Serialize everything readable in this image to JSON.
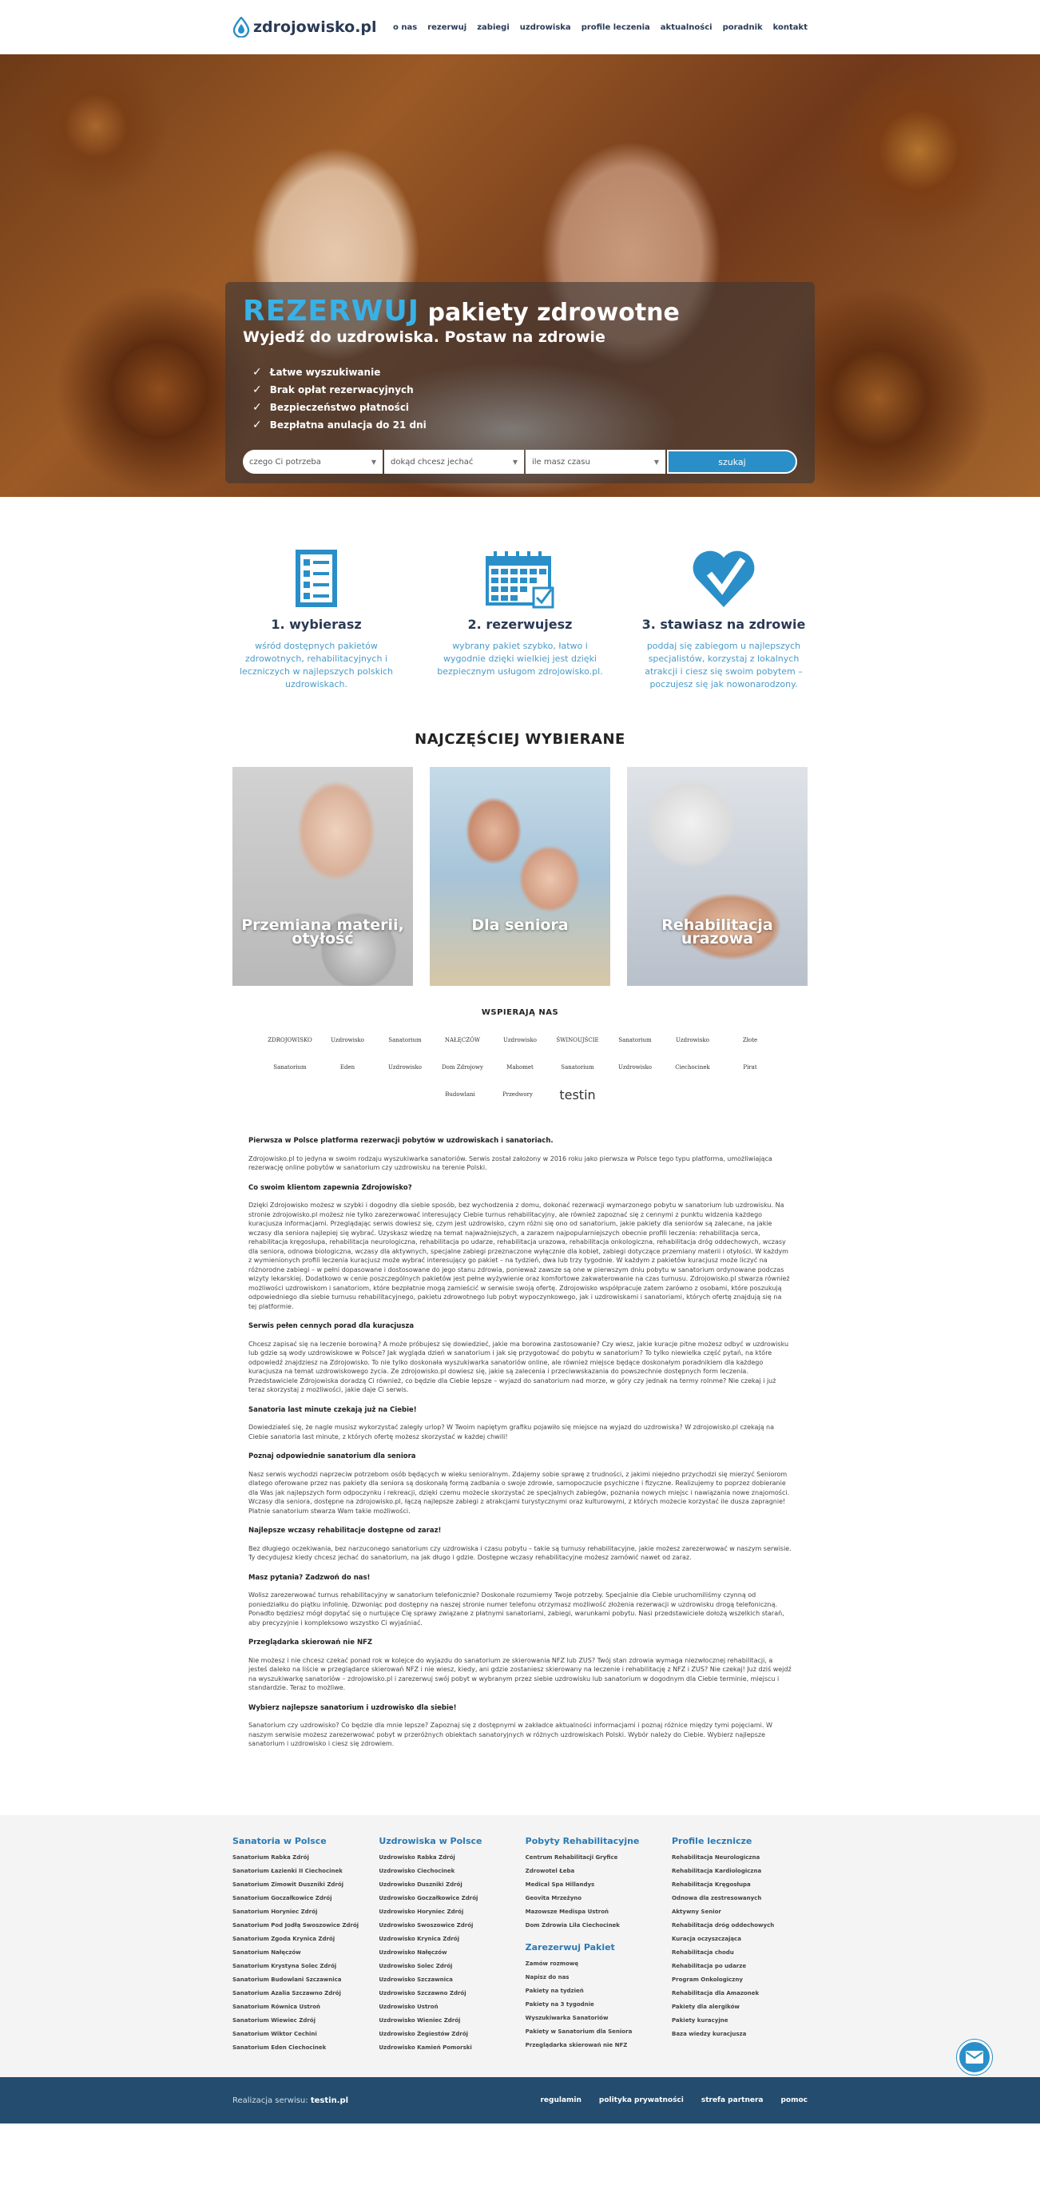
{
  "header": {
    "logo_text": "zdrojowisko.pl",
    "nav": [
      "o nas",
      "rezerwuj",
      "zabiegi",
      "uzdrowiska",
      "profile leczenia",
      "aktualności",
      "poradnik",
      "kontakt"
    ]
  },
  "hero": {
    "title_accent": "REZERWUJ",
    "title_rest": "pakiety zdrowotne",
    "subtitle": "Wyjedź do uzdrowiska. Postaw na zdrowie",
    "benefits": [
      "Łatwe wyszukiwanie",
      "Brak opłat rezerwacyjnych",
      "Bezpieczeństwo płatności",
      "Bezpłatna anulacja do 21 dni"
    ],
    "search": {
      "need": "czego Ci potrzeba",
      "where": "dokąd chcesz jechać",
      "time": "ile masz czasu",
      "button": "szukaj"
    }
  },
  "steps": [
    {
      "title": "1. wybierasz",
      "text": "wśród dostępnych pakietów zdrowotnych, rehabilitacyjnych i leczniczych w najlepszych polskich uzdrowiskach."
    },
    {
      "title": "2. rezerwujesz",
      "text": "wybrany pakiet szybko, łatwo i wygodnie dzięki wielkiej jest dzięki bezpiecznym usługom zdrojowisko.pl."
    },
    {
      "title": "3. stawiasz na zdrowie",
      "text": "poddaj się zabiegom u najlepszych specjalistów, korzystaj z lokalnych atrakcji i ciesz się swoim pobytem – poczujesz się jak nowonarodzony."
    }
  ],
  "popular": {
    "title": "NAJCZĘŚCIEJ WYBIERANE",
    "cards": [
      "Przemiana materii, otyłość",
      "Dla seniora",
      "Rehabilitacja urazowa"
    ]
  },
  "sponsors": {
    "title": "WSPIERAJĄ NAS",
    "logos": [
      "ZDROJOWISKO",
      "Uzdrowisko",
      "Sanatorium",
      "NAŁĘCZÓW",
      "Uzdrowisko",
      "ŚWINOUJŚCIE",
      "Sanatorium",
      "Uzdrowisko",
      "Złote",
      "Sanatorium",
      "Eden",
      "Uzdrowisko",
      "Dom Zdrojowy",
      "Mahomet",
      "Sanatorium",
      "Uzdrowisko",
      "Ciechocinek",
      "Pirat",
      "Budowlani",
      "Przedwory",
      "testin"
    ]
  },
  "article": {
    "intro_head": "Pierwsza w Polsce platforma rezerwacji pobytów w uzdrowiskach i sanatoriach.",
    "intro": "Zdrojowisko.pl to jedyna w swoim rodzaju wyszukiwarka sanatoriów. Serwis został założony w 2016 roku jako pierwsza w Polsce tego typu platforma, umożliwiająca rezerwację online pobytów w sanatorium czy uzdrowisku na terenie Polski.",
    "sections": [
      {
        "h": "Co swoim klientom zapewnia Zdrojowisko?",
        "p": "Dzięki Zdrojowisko możesz w szybki i dogodny dla siebie sposób, bez wychodzenia z domu, dokonać rezerwacji wymarzonego pobytu w sanatorium lub uzdrowisku. Na stronie zdrojowisko.pl możesz nie tylko zarezerwować interesujący Ciebie turnus rehabilitacyjny, ale również zapoznać się z cennymi z punktu widzenia każdego kuracjusza informacjami. Przeglądając serwis dowiesz się, czym jest uzdrowisko, czym różni się ono od sanatorium, jakie pakiety dla seniorów są zalecane, na jakie wczasy dla seniora najlepiej się wybrać. Uzyskasz wiedzę na temat najważniejszych, a zarazem najpopularniejszych obecnie profili leczenia: rehabilitacja serca, rehabilitacja kręgosłupa, rehabilitacja neurologiczna, rehabilitacja po udarze, rehabilitacja urazowa, rehabilitacja onkologiczna, rehabilitacja dróg oddechowych, wczasy dla seniora, odnowa biologiczna, wczasy dla aktywnych, specjalne zabiegi przeznaczone wyłącznie dla kobiet, zabiegi dotyczące przemiany materii i otyłości. W każdym z wymienionych profili leczenia kuracjusz może wybrać interesujący go pakiet – na tydzień, dwa lub trzy tygodnie. W każdym z pakietów kuracjusz może liczyć na różnorodne zabiegi – w pełni dopasowane i dostosowane do jego stanu zdrowia, ponieważ zawsze są one w pierwszym dniu pobytu w sanatorium ordynowane podczas wizyty lekarskiej. Dodatkowo w cenie poszczególnych pakietów jest pełne wyżywienie oraz komfortowe zakwaterowanie na czas turnusu. Zdrojowisko.pl stwarza również możliwości uzdrowiskom i sanatoriom, które bezpłatnie mogą zamieścić w serwisie swoją ofertę. Zdrojowisko współpracuje zatem zarówno z osobami, które poszukują odpowiedniego dla siebie turnusu rehabilitacyjnego, pakietu zdrowotnego lub pobyt wypoczynkowego, jak i uzdrowiskami i sanatoriami, których ofertę znajdują się na tej platformie."
      },
      {
        "h": "Serwis pełen cennych porad dla kuracjusza",
        "p": "Chcesz zapisać się na leczenie borowiną? A może próbujesz się dowiedzieć, jakie ma borowina zastosowanie? Czy wiesz, jakie kuracje pitne możesz odbyć w uzdrowisku lub gdzie są wody uzdrowiskowe w Polsce? Jak wygląda dzień w sanatorium i jak się przygotować do pobytu w sanatorium? To tylko niewielka część pytań, na które odpowiedź znajdziesz na Zdrojowisko. To nie tylko doskonała wyszukiwarka sanatoriów online, ale również miejsce będące doskonałym poradnikiem dla każdego kuracjusza na temat uzdrowiskowego życia. Ze zdrojowisko.pl dowiesz się, jakie są zalecenia i przeciwwskazania do powszechnie dostępnych form leczenia. Przedstawiciele Zdrojowiska doradzą Ci również, co będzie dla Ciebie lepsze – wyjazd do sanatorium nad morze, w góry czy jednak na termy rolnme? Nie czekaj i już teraz skorzystaj z możliwości, jakie daje Ci serwis."
      },
      {
        "h": "Sanatoria last minute czekają już na Ciebie!",
        "p": "Dowiedziałeś się, że nagle musisz wykorzystać zaległy urlop? W Twoim napiętym grafiku pojawiło się miejsce na wyjazd do uzdrowiska? W zdrojowisko.pl czekają na Ciebie sanatoria last minute, z których ofertę możesz skorzystać w każdej chwili!"
      },
      {
        "h": "Poznaj odpowiednie sanatorium dla seniora",
        "p": "Nasz serwis wychodzi naprzeciw potrzebom osób będących w wieku senioralnym. Zdajemy sobie sprawę z trudności, z jakimi niejedno przychodzi się mierzyć Seniorom dlatego oferowane przez nas pakiety dla seniora są doskonałą formą zadbania o swoje zdrowie, samopoczucie psychiczne i fizyczne. Realizujemy to poprzez dobieranie dla Was jak najlepszych form odpoczynku i rekreacji, dzięki czemu możecie skorzystać ze specjalnych zabiegów, poznania nowych miejsc i nawiązania nowe znajomości. Wczasy dla seniora, dostępne na zdrojowisko.pl, łączą najlepsze zabiegi z atrakcjami turystycznymi oraz kulturowymi, z których możecie korzystać ile dusza zapragnie! Platnie sanatorium stwarza Wam takie możliwości."
      },
      {
        "h": "Najlepsze wczasy rehabilitacje dostępne od zaraz!",
        "p": "Bez długiego oczekiwania, bez narzuconego sanatorium czy uzdrowiska i czasu pobytu – takie są turnusy rehabilitacyjne, jakie możesz zarezerwować w naszym serwisie. Ty decydujesz kiedy chcesz jechać do sanatorium, na jak długo i gdzie. Dostępne wczasy rehabilitacyjne możesz zamówić nawet od zaraz."
      },
      {
        "h": "Masz pytania? Zadzwoń do nas!",
        "p": "Wolisz zarezerwować turnus rehabilitacyjny w sanatorium telefonicznie? Doskonale rozumiemy Twoje potrzeby. Specjalnie dla Ciebie uruchomiliśmy czynną od poniedziałku do piątku infolinię. Dzwoniąc pod dostępny na naszej stronie numer telefonu otrzymasz możliwość złożenia rezerwacji w uzdrowisku drogą telefoniczną. Ponadto będziesz mógł dopytać się o nurtujące Cię sprawy związane z płatnymi sanatoriami, zabiegi, warunkami pobytu. Nasi przedstawiciele dołożą wszelkich starań, aby precyzyjnie i kompleksowo wszystko Ci wyjaśniać."
      },
      {
        "h": "Przeglądarka skierowań nie NFZ",
        "p": "Nie możesz i nie chcesz czekać ponad rok w kolejce do wyjazdu do sanatorium ze skierowania NFZ lub ZUS? Twój stan zdrowia wymaga niezwłocznej rehabilitacji, a jesteś daleko na liście w przeglądarce skierowań NFZ i nie wiesz, kiedy, ani gdzie zostaniesz skierowany na leczenie i rehabilitację z NFZ i ZUS? Nie czekaj! Już dziś wejdź na wyszukiwarkę sanatoriów – zdrojowisko.pl i zarezerwuj swój pobyt w wybranym przez siebie uzdrowisku lub sanatorium w dogodnym dla Ciebie terminie, miejscu i standardzie. Teraz to możliwe."
      },
      {
        "h": "Wybierz najlepsze sanatorium i uzdrowisko dla siebie!",
        "p": "Sanatorium czy uzdrowisko? Co będzie dla mnie lepsze? Zapoznaj się z dostępnymi w zakładce aktualności informacjami i poznaj różnice między tymi pojęciami. W naszym serwisie możesz zarezerwować pobyt w przeróżnych obiektach sanatoryjnych w różnych uzdrowiskach Polski. Wybór należy do Ciebie. Wybierz najlepsze sanatorium i uzdrowisko i ciesz się zdrowiem."
      }
    ]
  },
  "footer": {
    "col1": {
      "title": "Sanatoria w Polsce",
      "items": [
        "Sanatorium Rabka Zdrój",
        "Sanatorium Łazienki II Ciechocinek",
        "Sanatorium Zimowit Duszniki Zdrój",
        "Sanatorium Goczałkowice Zdrój",
        "Sanatorium Horyniec Zdrój",
        "Sanatorium Pod Jodłą Swoszowice Zdrój",
        "Sanatorium Zgoda Krynica Zdrój",
        "Sanatorium Nałęczów",
        "Sanatorium Krystyna Solec Zdrój",
        "Sanatorium Budowlani Szczawnica",
        "Sanatorium Azalia Szczawno Zdrój",
        "Sanatorium Równica Ustroń",
        "Sanatorium Wiewiec Zdrój",
        "Sanatorium Wiktor Cechini",
        "Sanatorium Eden Ciechocinek"
      ]
    },
    "col2": {
      "title": "Uzdrowiska w Polsce",
      "items": [
        "Uzdrowisko Rabka Zdrój",
        "Uzdrowisko Ciechocinek",
        "Uzdrowisko Duszniki Zdrój",
        "Uzdrowisko Goczałkowice Zdrój",
        "Uzdrowisko Horyniec Zdrój",
        "Uzdrowisko Swoszowice Zdrój",
        "Uzdrowisko Krynica Zdrój",
        "Uzdrowisko Nałęczów",
        "Uzdrowisko Solec Zdrój",
        "Uzdrowisko Szczawnica",
        "Uzdrowisko Szczawno Zdrój",
        "Uzdrowisko Ustroń",
        "Uzdrowisko Wieniec Zdrój",
        "Uzdrowisko Żegiestów Zdrój",
        "Uzdrowisko Kamień Pomorski"
      ]
    },
    "col3": {
      "title": "Pobyty Rehabilitacyjne",
      "items": [
        "Centrum Rehabilitacji Gryfice",
        "Zdrowotel Łeba",
        "Medical Spa Hillandys",
        "Geovita Mrzeżyno",
        "Mazowsze Medispa Ustroń",
        "Dom Zdrowia Lila Ciechocinek"
      ],
      "title2": "Zarezerwuj Pakiet",
      "items2": [
        "Zamów rozmowę",
        "Napisz do nas",
        "Pakiety na tydzień",
        "Pakiety na 3 tygodnie",
        "Wyszukiwarka Sanatoriów",
        "Pakiety w Sanatorium dla Seniora",
        "Przeglądarka skierowań nie NFZ"
      ]
    },
    "col4": {
      "title": "Profile lecznicze",
      "items": [
        "Rehabilitacja Neurologiczna",
        "Rehabilitacja Kardiologiczna",
        "Rehabilitacja Kręgosłupa",
        "Odnowa dla zestresowanych",
        "Aktywny Senior",
        "Rehabilitacja dróg oddechowych",
        "Kuracja oczyszczająca",
        "Rehabilitacja chodu",
        "Rehabilitacja po udarze",
        "Program Onkologiczny",
        "Rehabilitacja dla Amazonek",
        "Pakiety dla alergików",
        "Pakiety kuracyjne",
        "Baza wiedzy kuracjusza"
      ]
    },
    "credit_label": "Realizacja serwisu:",
    "credit_name": "testin.pl",
    "links": [
      "regulamin",
      "polityka prywatności",
      "strefa partnera",
      "pomoc"
    ]
  },
  "colors": {
    "accent": "#38b1e6",
    "brand_dark": "#2a3a55",
    "footer_bar": "#244c6e",
    "button": "#2a8fc8"
  }
}
